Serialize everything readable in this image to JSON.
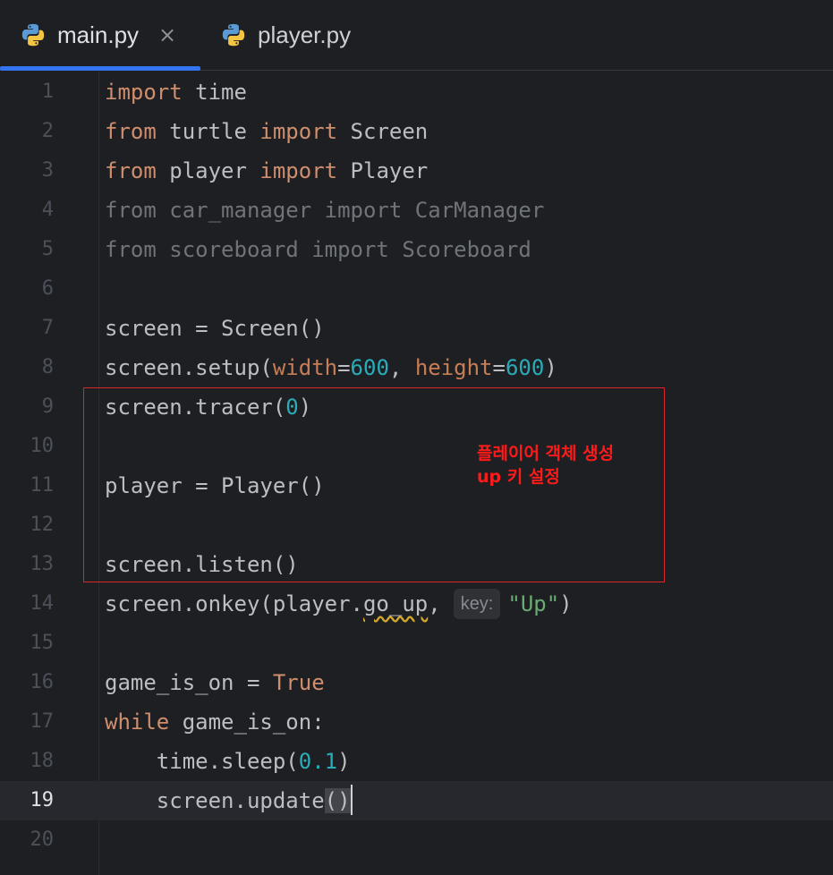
{
  "tabs": [
    {
      "label": "main.py",
      "active": true,
      "close": "×"
    },
    {
      "label": "player.py",
      "active": false
    }
  ],
  "colors": {
    "background": "#1e1f22",
    "keyword": "#cf8e6d",
    "number": "#2aacb8",
    "string": "#6aab73",
    "accent": "#3574f0",
    "annotation": "#ff1a1a"
  },
  "lines": [
    {
      "n": "1",
      "code": [
        {
          "t": "import",
          "c": "kw"
        },
        {
          "t": " time"
        }
      ]
    },
    {
      "n": "2",
      "code": [
        {
          "t": "from",
          "c": "kw"
        },
        {
          "t": " turtle "
        },
        {
          "t": "import",
          "c": "kw"
        },
        {
          "t": " Screen"
        }
      ]
    },
    {
      "n": "3",
      "code": [
        {
          "t": "from",
          "c": "kw"
        },
        {
          "t": " player "
        },
        {
          "t": "import",
          "c": "kw"
        },
        {
          "t": " Player"
        }
      ]
    },
    {
      "n": "4",
      "code": [
        {
          "t": "from car_manager import CarManager",
          "c": "dim"
        }
      ]
    },
    {
      "n": "5",
      "code": [
        {
          "t": "from scoreboard import Scoreboard",
          "c": "dim"
        }
      ]
    },
    {
      "n": "6",
      "code": []
    },
    {
      "n": "7",
      "code": [
        {
          "t": "screen = Screen()"
        }
      ]
    },
    {
      "n": "8",
      "code": [
        {
          "t": "screen.setup("
        },
        {
          "t": "width",
          "c": "param"
        },
        {
          "t": "="
        },
        {
          "t": "600",
          "c": "num"
        },
        {
          "t": ", "
        },
        {
          "t": "height",
          "c": "param"
        },
        {
          "t": "="
        },
        {
          "t": "600",
          "c": "num"
        },
        {
          "t": ")"
        }
      ]
    },
    {
      "n": "9",
      "code": [
        {
          "t": "screen.tracer("
        },
        {
          "t": "0",
          "c": "num"
        },
        {
          "t": ")"
        }
      ]
    },
    {
      "n": "10",
      "code": []
    },
    {
      "n": "11",
      "code": [
        {
          "t": "player = Player()"
        }
      ]
    },
    {
      "n": "12",
      "code": []
    },
    {
      "n": "13",
      "code": [
        {
          "t": "screen.listen()"
        }
      ]
    },
    {
      "n": "14",
      "code": [
        {
          "t": "screen.onkey(player."
        },
        {
          "t": "go_up",
          "c": "warn"
        },
        {
          "t": ","
        },
        {
          "t": "key:",
          "c": "hint"
        },
        {
          "t": "\"Up\"",
          "c": "str"
        },
        {
          "t": ")"
        }
      ]
    },
    {
      "n": "15",
      "code": []
    },
    {
      "n": "16",
      "code": [
        {
          "t": "game_is_on = "
        },
        {
          "t": "True",
          "c": "kw"
        }
      ]
    },
    {
      "n": "17",
      "code": [
        {
          "t": "while",
          "c": "kw"
        },
        {
          "t": " game_is_on:"
        }
      ]
    },
    {
      "n": "18",
      "code": [
        {
          "t": "    time.sleep("
        },
        {
          "t": "0.1",
          "c": "num"
        },
        {
          "t": ")"
        }
      ]
    },
    {
      "n": "19",
      "current": true,
      "code": [
        {
          "t": "    screen.update"
        },
        {
          "t": "()",
          "c": "brace-match"
        },
        {
          "t": "",
          "c": "caret"
        }
      ]
    },
    {
      "n": "20",
      "code": []
    }
  ],
  "annotation": {
    "line1": "플레이어 객체 생성",
    "line2": "up 키 설정"
  }
}
